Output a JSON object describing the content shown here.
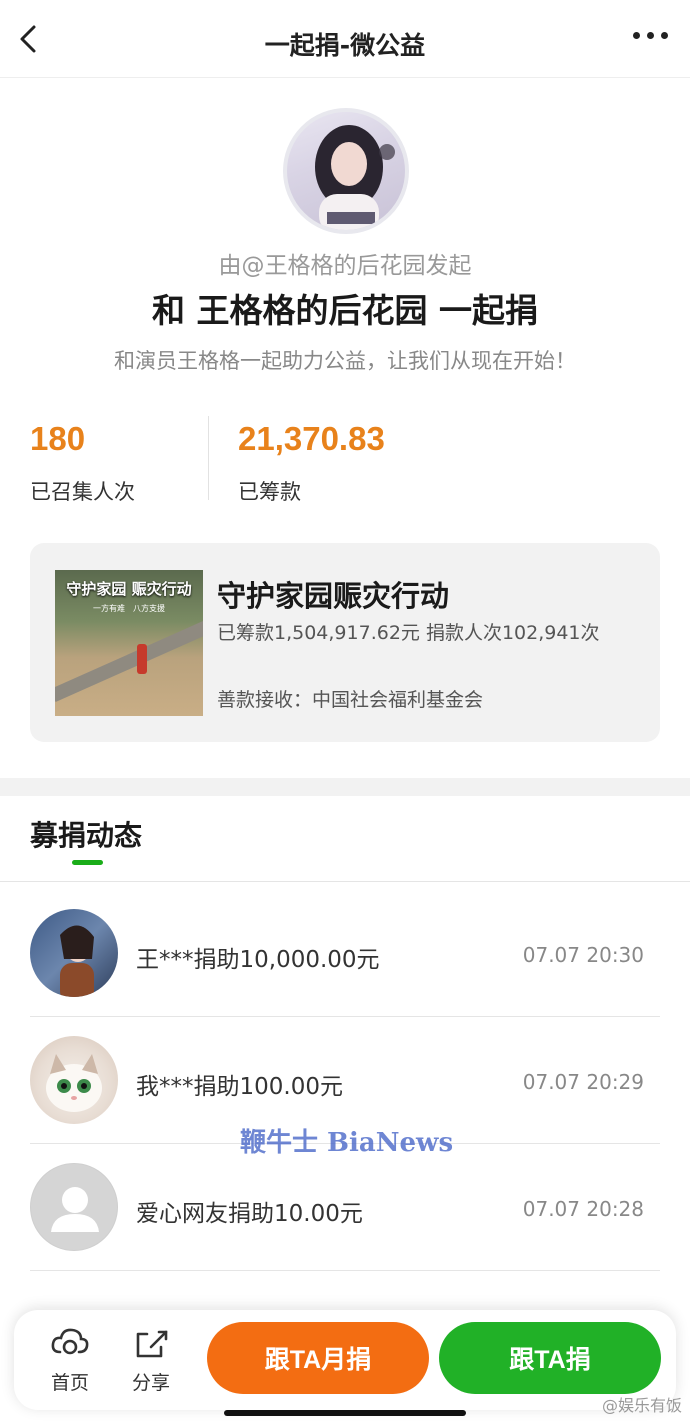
{
  "nav": {
    "title": "一起捐-微公益"
  },
  "header": {
    "sponsor": "由@王格格的后花园发起",
    "headline": "和 王格格的后花园 一起捐",
    "subtitle": "和演员王格格一起助力公益，让我们从现在开始！"
  },
  "stats": {
    "people_value": "180",
    "people_label": "已召集人次",
    "amount_value": "21,370.83",
    "amount_label": "已筹款"
  },
  "project": {
    "thumb_title": "守护家园 赈灾行动",
    "thumb_sub": "一方有难　八方支援",
    "title": "守护家园赈灾行动",
    "stats_line": "已筹款1,504,917.62元  捐款人次102,941次",
    "receiver": "善款接收：中国社会福利基金会"
  },
  "tab": {
    "label": "募捐动态"
  },
  "feed": [
    {
      "text": "王***捐助10,000.00元",
      "time": "07.07 20:30"
    },
    {
      "text": "我***捐助100.00元",
      "time": "07.07 20:29"
    },
    {
      "text": "爱心网友捐助10.00元",
      "time": "07.07 20:28"
    }
  ],
  "watermark": "鞭牛士 BiaNews",
  "bottom": {
    "home_label": "首页",
    "share_label": "分享",
    "monthly_button": "跟TA月捐",
    "donate_button": "跟TA捐"
  },
  "corner_mark": "@娱乐有饭",
  "colors": {
    "accent_orange": "#e8821b",
    "button_orange": "#f36d12",
    "button_green": "#21b127",
    "tab_green": "#1aad19"
  }
}
